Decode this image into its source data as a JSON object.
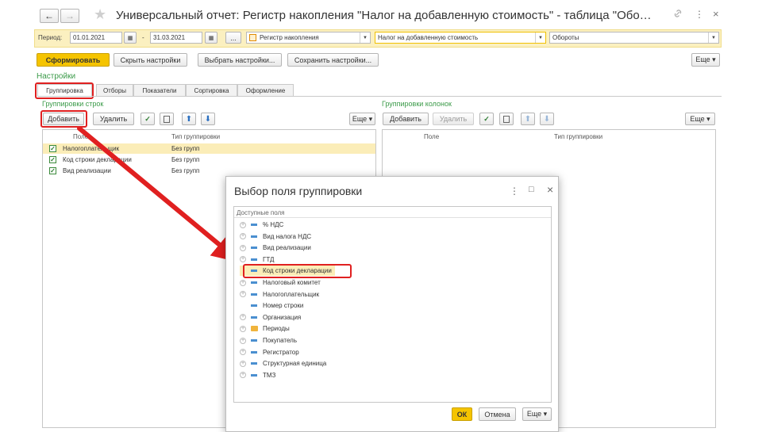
{
  "window": {
    "title": "Универсальный отчет: Регистр накопления \"Налог на добавленную стоимость\" - таблица \"Обо…",
    "nav_back": "←",
    "nav_forward": "→",
    "star": "★",
    "link": "🔗",
    "more": "⋮",
    "close": "×"
  },
  "filter": {
    "period_label": "Период:",
    "date_from": "01.01.2021",
    "dash": "-",
    "date_to": "31.03.2021",
    "dots": "...",
    "source_type": "Регистр накопления",
    "source_name": "Налог на добавленную стоимость",
    "table_name": "Обороты"
  },
  "toolbar": {
    "generate": "Сформировать",
    "hide_settings": "Скрыть настройки",
    "choose_settings": "Выбрать настройки...",
    "save_settings": "Сохранить настройки...",
    "more": "Еще ▾"
  },
  "settings": {
    "title": "Настройки",
    "tabs": [
      "Группировка",
      "Отборы",
      "Показатели",
      "Сортировка",
      "Оформление"
    ]
  },
  "row_groups": {
    "title": "Группировки строк",
    "add": "Добавить",
    "remove": "Удалить",
    "more": "Еще ▾",
    "col_field": "Поле",
    "col_type": "Тип группировки",
    "rows": [
      {
        "field": "Налогоплательщик",
        "type": "Без групп",
        "checked": true
      },
      {
        "field": "Код строки декларации",
        "type": "Без групп",
        "checked": true
      },
      {
        "field": "Вид реализации",
        "type": "Без групп",
        "checked": true
      }
    ]
  },
  "col_groups": {
    "title": "Группировки колонок",
    "add": "Добавить",
    "remove": "Удалить",
    "more": "Еще ▾",
    "col_field": "Поле",
    "col_type": "Тип группировки"
  },
  "dialog": {
    "title": "Выбор поля группировки",
    "more": "⋮",
    "minimize": "□",
    "close": "×",
    "list_header": "Доступные поля",
    "items": [
      {
        "label": "% НДС",
        "expandable": true,
        "icon": "field"
      },
      {
        "label": "Вид налога НДС",
        "expandable": true,
        "icon": "field"
      },
      {
        "label": "Вид реализации",
        "expandable": true,
        "icon": "field"
      },
      {
        "label": "ГТД",
        "expandable": true,
        "icon": "field"
      },
      {
        "label": "Код строки декларации",
        "expandable": false,
        "icon": "field",
        "selected": true
      },
      {
        "label": "Налоговый комитет",
        "expandable": true,
        "icon": "field"
      },
      {
        "label": "Налогоплательщик",
        "expandable": true,
        "icon": "field"
      },
      {
        "label": "Номер строки",
        "expandable": false,
        "icon": "field"
      },
      {
        "label": "Организация",
        "expandable": true,
        "icon": "field"
      },
      {
        "label": "Периоды",
        "expandable": true,
        "icon": "folder"
      },
      {
        "label": "Покупатель",
        "expandable": true,
        "icon": "field"
      },
      {
        "label": "Регистратор",
        "expandable": true,
        "icon": "field"
      },
      {
        "label": "Структурная единица",
        "expandable": true,
        "icon": "field"
      },
      {
        "label": "ТМЗ",
        "expandable": true,
        "icon": "field"
      }
    ],
    "ok": "ОК",
    "cancel": "Отмена",
    "more_btn": "Еще ▾"
  },
  "colors": {
    "accent_yellow": "#f5c400",
    "highlight_red": "#e02020",
    "green_title": "#3a9a48",
    "selected_row": "#fbedb8"
  }
}
